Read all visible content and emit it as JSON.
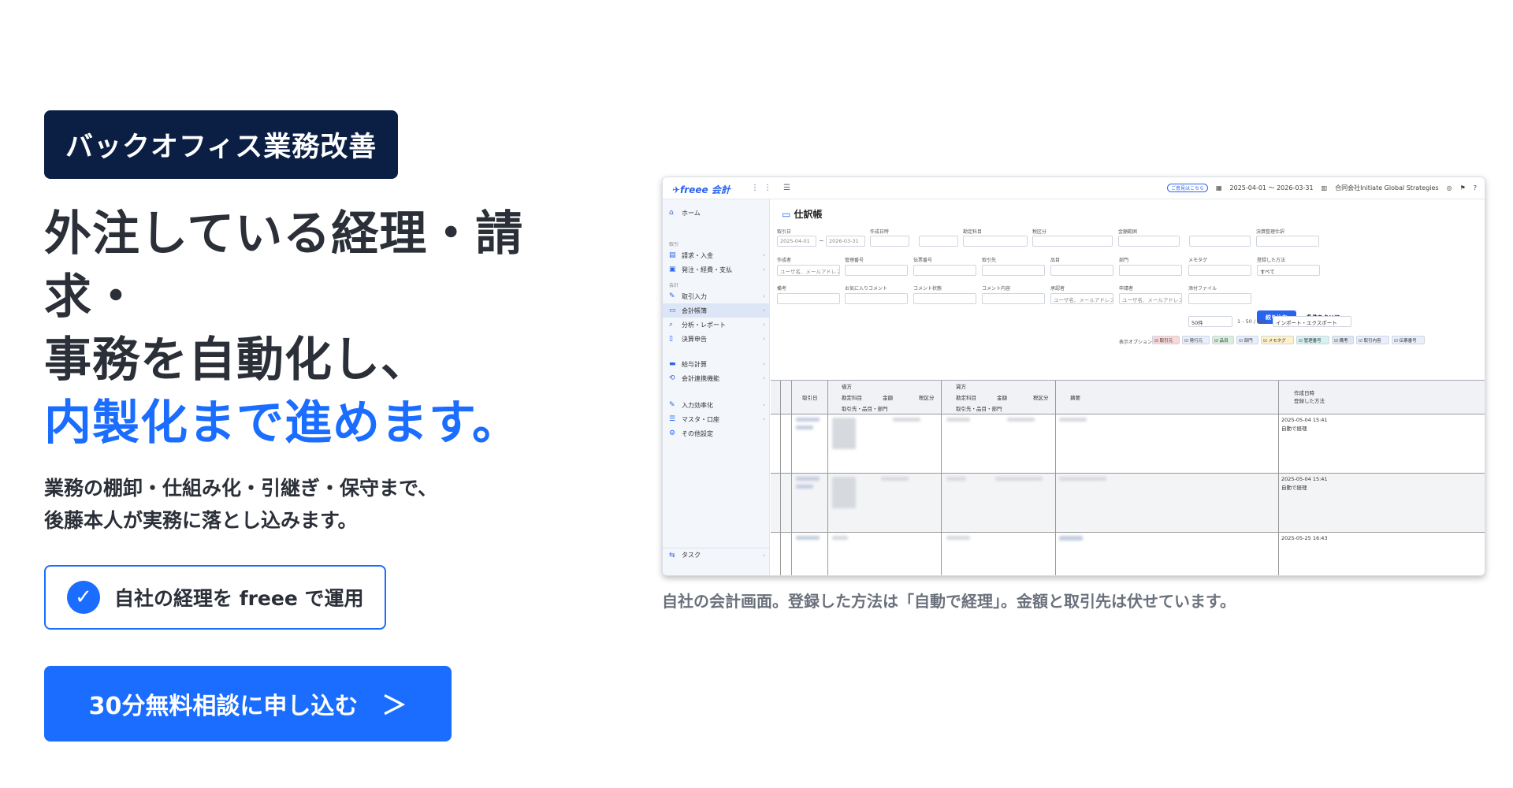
{
  "hero": {
    "tag": "バックオフィス業務改善",
    "headline_line1": "外注している経理・請求・",
    "headline_line2": "事務を自動化し、",
    "headline_line3": "内製化まで進めます。",
    "sub_line1": "業務の棚卸・仕組み化・引継ぎ・保守まで、",
    "sub_line2": "後藤本人が実務に落とし込みます。",
    "badge_check": "✓",
    "badge_text": "自社の経理を freee で運用",
    "cta_label": "30分無料相談に申し込む",
    "cta_arrow": "＞"
  },
  "screenshot": {
    "logo": "✈freee 会計",
    "topbar": {
      "pill": "ご意見はこちら",
      "period": "2025-04-01 〜 2026-03-31",
      "company": "合同会社Initiate Global Strategies"
    },
    "sidebar": {
      "home": "ホーム",
      "sec_torihiki": "取引",
      "seikyu": "請求・入金",
      "hatchu": "発注・経費・支払",
      "sec_kaikei": "会計",
      "torihiki_input": "取引入力",
      "kaikei_chobo": "会計帳簿",
      "bunseki": "分析・レポート",
      "kessan": "決算申告",
      "kyuyo": "給与計算",
      "renkei": "会計連携機能",
      "jido": "入力効率化",
      "master": "マスタ・口座",
      "settings": "その他設定",
      "task": "タスク"
    },
    "page_title": "仕訳帳",
    "filters": {
      "date_label": "取引日",
      "date_from": "2025-04-01",
      "date_to": "2026-03-31",
      "created_label": "作成日時",
      "account_label": "勘定科目",
      "tax_label": "税区分",
      "amount_label": "金額範囲",
      "settle_label": "決算整理仕訳",
      "creator_label": "作成者",
      "user_placeholder": "ユーザ名、メールアドレス",
      "manage_label": "管理番号",
      "voucher_label": "伝票番号",
      "partner_label": "取引先",
      "item_label": "品目",
      "dept_label": "部門",
      "memo_label": "メモタグ",
      "method_label": "登録した方法",
      "method_value": "すべて",
      "note_label": "備考",
      "fav_label": "お気に入りコメント",
      "comment_state_label": "コメント状態",
      "comment_label": "コメント内容",
      "approver_label": "承認者",
      "applicant_label": "申請者",
      "file_label": "添付ファイル",
      "filter_button": "絞り込む",
      "clear_button": "条件をクリア"
    },
    "pager": {
      "per_page": "50件",
      "range": "1 - 50 / 621",
      "export": "インポート・エクスポート"
    },
    "display_options_label": "表示オプション",
    "display_options": [
      "取引元",
      "発行元",
      "品目",
      "部門",
      "メモタグ",
      "管理番号",
      "備考",
      "取引内容",
      "伝票番号"
    ],
    "columns": {
      "date": "取引日",
      "debit": "借方",
      "credit": "貸方",
      "account": "勘定科目",
      "amount": "金額",
      "tax": "税区分",
      "sub": "取引先・品目・部門",
      "summary": "摘要",
      "created": "作成日時",
      "method": "登録した方法"
    },
    "rows": [
      {
        "created": "2025-05-04 15:41",
        "method": "自動で経理"
      },
      {
        "created": "2025-05-04 15:41",
        "method": "自動で経理"
      },
      {
        "created": "2025-05-25 16:43",
        "method": ""
      }
    ]
  },
  "caption": "自社の会計画面。登録した方法は「自動で経理」。金額と取引先は伏せています。"
}
